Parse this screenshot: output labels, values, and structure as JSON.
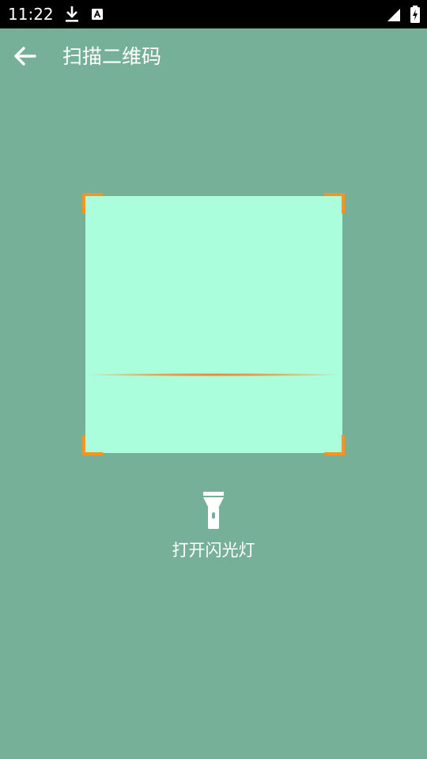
{
  "status_bar": {
    "time": "11:22",
    "icons": [
      "download-icon",
      "a-icon",
      "signal-icon",
      "battery-charging-icon"
    ]
  },
  "toolbar": {
    "back_icon": "arrow-left-icon",
    "title": "扫描二维码"
  },
  "scanner": {
    "frame_color": "#abfedb",
    "corner_color": "#f7931e",
    "scan_line_color": "#f07614"
  },
  "flashlight": {
    "icon": "flashlight-icon",
    "label": "打开闪光灯"
  },
  "colors": {
    "background": "#76b098",
    "status_bar": "#000000",
    "text": "#ffffff"
  }
}
